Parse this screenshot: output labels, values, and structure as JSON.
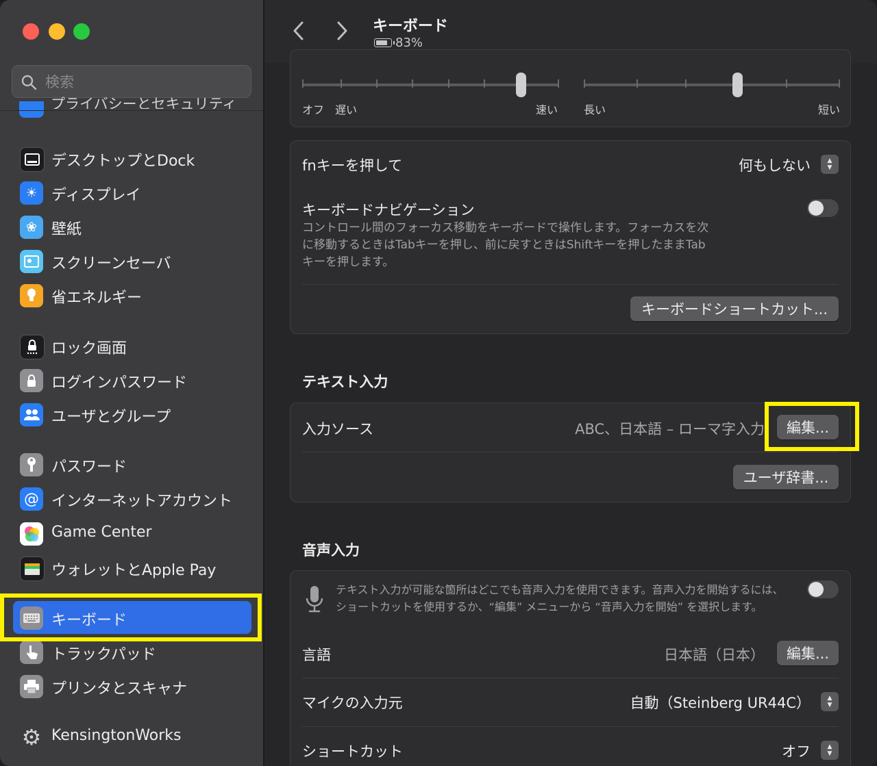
{
  "window": {
    "traffic_lights": {
      "close": "#fe5f57",
      "minimize": "#febc2e",
      "zoom": "#28c840"
    }
  },
  "sidebar": {
    "search_placeholder": "検索",
    "partial_item_label": "プライバシーとセキュリティ",
    "items": [
      {
        "label": "デスクトップとDock",
        "icon": "dock-icon",
        "color": "#1c1c1e"
      },
      {
        "label": "ディスプレイ",
        "icon": "sun-icon",
        "color": "#2b7df3"
      },
      {
        "label": "壁紙",
        "icon": "flower-icon",
        "color": "#4aa8f0"
      },
      {
        "label": "スクリーンセーバ",
        "icon": "screensaver-icon",
        "color": "#5ac3f2"
      },
      {
        "label": "省エネルギー",
        "icon": "lightbulb-icon",
        "color": "#f5a623"
      },
      {
        "label": "ロック画面",
        "icon": "lock-screen-icon",
        "color": "#1c1c1e"
      },
      {
        "label": "ログインパスワード",
        "icon": "lock-icon",
        "color": "#8e8e93"
      },
      {
        "label": "ユーザとグループ",
        "icon": "users-icon",
        "color": "#2b7df3"
      },
      {
        "label": "パスワード",
        "icon": "key-icon",
        "color": "#8e8e93"
      },
      {
        "label": "インターネットアカウント",
        "icon": "at-icon",
        "color": "#2b7df3"
      },
      {
        "label": "Game Center",
        "icon": "game-center-icon",
        "color": "#ffffff"
      },
      {
        "label": "ウォレットとApple Pay",
        "icon": "wallet-icon",
        "color": "#1c1c1e"
      },
      {
        "label": "キーボード",
        "icon": "keyboard-icon",
        "color": "#8e8e93",
        "selected": true
      },
      {
        "label": "トラックパッド",
        "icon": "trackpad-icon",
        "color": "#8e8e93"
      },
      {
        "label": "プリンタとスキャナ",
        "icon": "printer-icon",
        "color": "#8e8e93"
      },
      {
        "label": "KensingtonWorks",
        "icon": "gear-icon",
        "color": "#3c3c3e"
      }
    ],
    "selected_color": "#2f6ee6"
  },
  "toolbar": {
    "title": "キーボード",
    "battery": "83%"
  },
  "key_repeat": {
    "repeat_labels": {
      "off": "オフ",
      "slow": "遅い",
      "fast": "速い"
    },
    "delay_labels": {
      "long": "長い",
      "short": "短い"
    },
    "repeat_level": 0.85,
    "delay_level": 0.6
  },
  "fn_section": {
    "fn_label": "fnキーを押して",
    "fn_value": "何もしない",
    "nav_label": "キーボードナビゲーション",
    "nav_desc_1": "コントロール間のフォーカス移動をキーボードで操作します。フォーカスを次",
    "nav_desc_2": "に移動するときはTabキーを押し、前に戻すときはShiftキーを押したままTab",
    "nav_desc_3": "キーを押します。",
    "shortcuts_button": "キーボードショートカット..."
  },
  "text_input": {
    "title": "テキスト入力",
    "source_label": "入力ソース",
    "source_value": "ABC、日本語 – ローマ字入力",
    "edit_button": "編集...",
    "dictionary_button": "ユーザ辞書..."
  },
  "dictation": {
    "title": "音声入力",
    "desc_1": "テキスト入力が可能な箇所はどこでも音声入力を使用できます。音声入力を開始するには、",
    "desc_2": "ショートカットを使用するか、“編集” メニューから “音声入力を開始” を選択します。",
    "language_label": "言語",
    "language_value": "日本語（日本）",
    "language_edit_button": "編集...",
    "mic_label": "マイクの入力元",
    "mic_value": "自動（Steinberg UR44C）",
    "shortcut_label": "ショートカット",
    "shortcut_value": "オフ"
  },
  "highlight_color": "#fff200"
}
